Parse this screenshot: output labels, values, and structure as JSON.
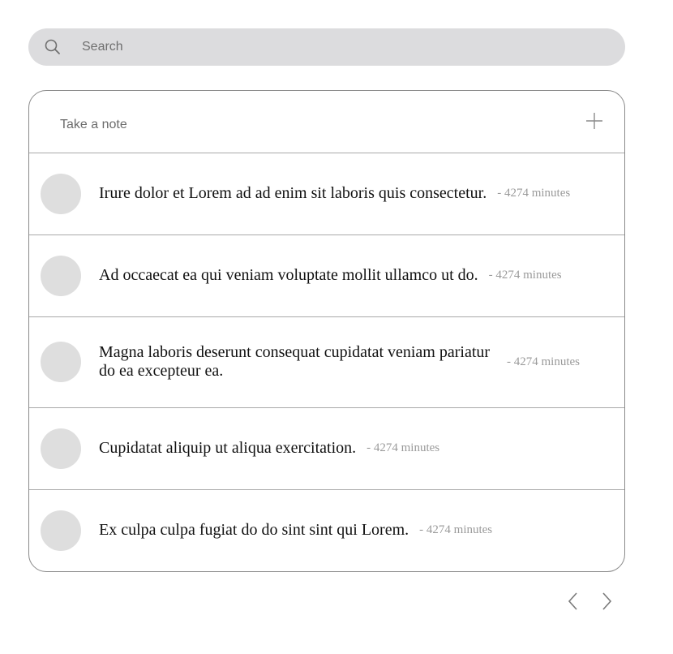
{
  "search": {
    "placeholder": "Search",
    "icon": "search-icon"
  },
  "composer": {
    "placeholder": "Take a note",
    "add_icon": "plus-icon"
  },
  "notes": [
    {
      "text": "Irure dolor et Lorem ad ad enim sit laboris quis consectetur.",
      "meta": "- 4274 minutes"
    },
    {
      "text": "Ad occaecat ea qui veniam voluptate mollit ullamco ut do.",
      "meta": "- 4274 minutes"
    },
    {
      "text": "Magna laboris deserunt consequat cupidatat veniam pariatur do ea excepteur ea.",
      "meta": "- 4274 minutes"
    },
    {
      "text": "Cupidatat aliquip ut aliqua exercitation.",
      "meta": "- 4274 minutes"
    },
    {
      "text": "Ex culpa culpa fugiat do do sint sint qui Lorem.",
      "meta": "- 4274 minutes"
    }
  ],
  "pagination": {
    "prev_icon": "chevron-left-icon",
    "next_icon": "chevron-right-icon"
  },
  "colors": {
    "search_bg": "#dcdcde",
    "border": "#a9a9a9",
    "avatar": "#dedede",
    "meta_text": "#9a9a9a"
  }
}
